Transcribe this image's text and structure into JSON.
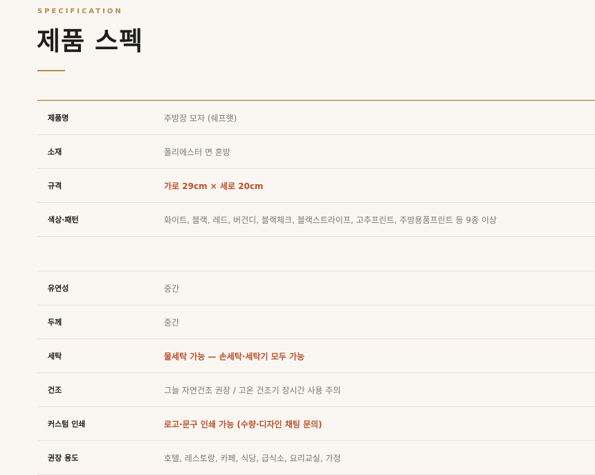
{
  "header": {
    "eyebrow": "SPECIFICATION",
    "title": "제품 스펙"
  },
  "colors": {
    "accent_gold": "#b38a52",
    "accent_red": "#b8502e",
    "background": "#faf7f2"
  },
  "specs_group1": [
    {
      "label": "제품명",
      "value": "주방장 모자 (쉐프햇)",
      "highlight": false
    },
    {
      "label": "소재",
      "value": "폴리에스터 면 혼방",
      "highlight": false
    },
    {
      "label": "규격",
      "value": "가로 29cm × 세로 20cm",
      "highlight": true
    },
    {
      "label": "색상·패턴",
      "value": "화이트, 블랙, 레드, 버건디, 블랙체크, 블랙스트라이프, 고추프린트, 주방용품프린트 등 9종 이상",
      "highlight": false
    }
  ],
  "specs_group2": [
    {
      "label": "유연성",
      "value": "중간",
      "highlight": false
    },
    {
      "label": "두께",
      "value": "중간",
      "highlight": false
    },
    {
      "label": "세탁",
      "value": "물세탁 가능 — 손세탁·세탁기 모두 가능",
      "highlight": true
    },
    {
      "label": "건조",
      "value": "그늘 자연건조 권장 / 고온 건조기 장시간 사용 주의",
      "highlight": false
    },
    {
      "label": "커스텀 인쇄",
      "value": "로고·문구 인쇄 가능 (수량·디자인 채팅 문의)",
      "highlight": true
    },
    {
      "label": "권장 용도",
      "value": "호텔, 레스토랑, 카페, 식당, 급식소, 요리교실, 가정",
      "highlight": false
    }
  ]
}
